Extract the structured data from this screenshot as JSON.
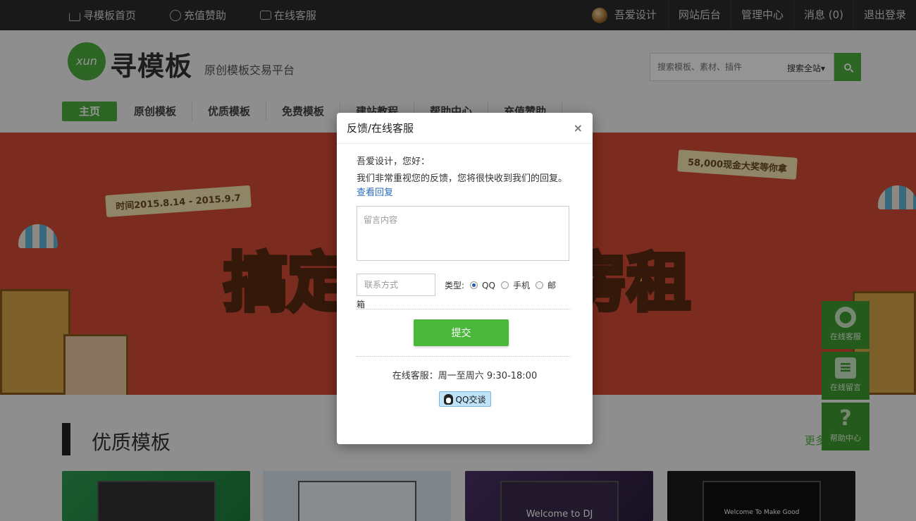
{
  "topbar": {
    "left": [
      {
        "label": "寻模板首页",
        "icon": "home-icon"
      },
      {
        "label": "充值赞助",
        "icon": "coin-icon"
      },
      {
        "label": "在线客服",
        "icon": "chat-icon"
      }
    ],
    "username": "吾爱设计",
    "right": [
      "网站后台",
      "管理中心",
      "消息 (0)",
      "退出登录"
    ]
  },
  "header": {
    "logo_mark": "xun",
    "logo_text": "寻模板",
    "slogan": "原创模板交易平台",
    "search_placeholder": "搜索模板、素材、插件",
    "search_scope": "搜索全站▾"
  },
  "nav": [
    "主页",
    "原创模板",
    "优质模板",
    "免费模板",
    "建站教程",
    "帮助中心",
    "充值赞助"
  ],
  "banner": {
    "time_ribbon": "时间2015.8.14 - 2015.9.7",
    "prize_ribbon": "58,000现金大奖等你拿",
    "headline_left": "搞定",
    "headline_right": "房租"
  },
  "section": {
    "title": "优质模板",
    "more": "更多",
    "cards": [
      "",
      "",
      "Welcome to DJ",
      "Welcome To Make Good"
    ]
  },
  "tools": [
    "在线客服",
    "在线留言",
    "帮助中心"
  ],
  "modal": {
    "title": "反馈/在线客服",
    "close": "×",
    "greeting": "吾爱设计，您好：",
    "message": "我们非常重视您的反馈，您将很快收到我们的回复。",
    "view_reply": "查看回复",
    "textarea_placeholder": "留言内容",
    "contact_placeholder": "联系方式",
    "type_label": "类型:",
    "types": [
      "QQ",
      "手机",
      "邮"
    ],
    "type_continuation": "箱",
    "submit": "提交",
    "service_hours": "在线客服：周一至周六 9:30-18:00",
    "qq_button": "QQ交谈"
  }
}
